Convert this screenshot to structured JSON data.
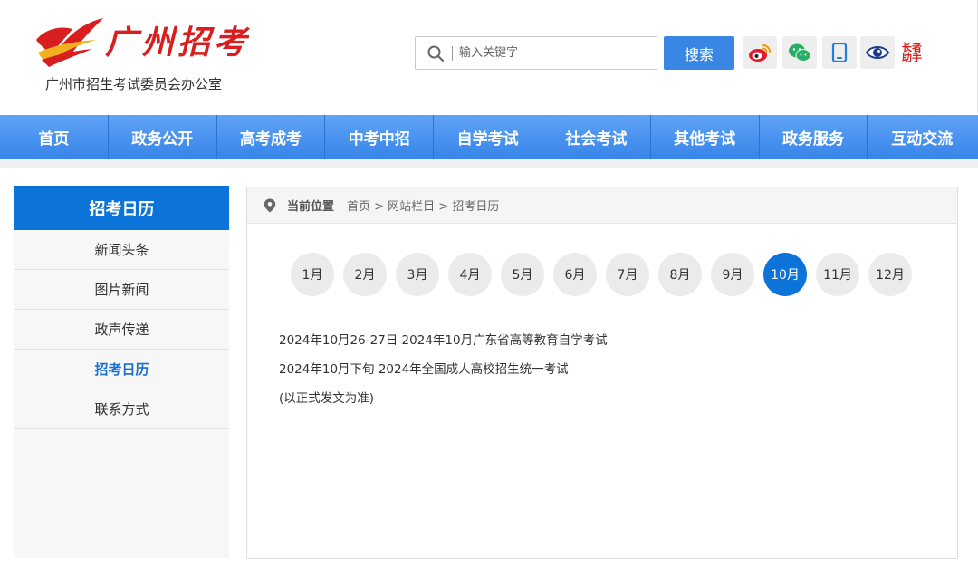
{
  "header": {
    "logo_script": "广州招考",
    "logo_subtitle": "广州市招生考试委员会办公室",
    "search_placeholder": "输入关键字",
    "search_button": "搜索",
    "tools": [
      {
        "name": "weibo",
        "icon": "weibo-icon"
      },
      {
        "name": "wechat",
        "icon": "wechat-icon"
      },
      {
        "name": "mobile",
        "icon": "mobile-icon"
      },
      {
        "name": "accessibility",
        "icon": "eye-icon"
      },
      {
        "name": "elder-assistant",
        "icon": "elder-assistant-icon",
        "label_line1": "长者",
        "label_line2": "助手"
      }
    ],
    "colors": {
      "brand_red": "#d81e1e",
      "nav_blue": "#3a86e4",
      "active_blue": "#0c74d9"
    }
  },
  "nav": {
    "items": [
      "首页",
      "政务公开",
      "高考成考",
      "中考中招",
      "自学考试",
      "社会考试",
      "其他考试",
      "政务服务",
      "互动交流"
    ]
  },
  "sidebar": {
    "title": "招考日历",
    "items": [
      {
        "label": "新闻头条",
        "active": false
      },
      {
        "label": "图片新闻",
        "active": false
      },
      {
        "label": "政声传递",
        "active": false
      },
      {
        "label": "招考日历",
        "active": true
      },
      {
        "label": "联系方式",
        "active": false
      }
    ]
  },
  "breadcrumb": {
    "label": "当前位置",
    "path": "首页 > 网站栏目 > 招考日历"
  },
  "calendar": {
    "months": [
      "1月",
      "2月",
      "3月",
      "4月",
      "5月",
      "6月",
      "7月",
      "8月",
      "9月",
      "10月",
      "11月",
      "12月"
    ],
    "selected": "10月",
    "events": [
      "2024年10月26-27日 2024年10月广东省高等教育自学考试",
      "2024年10月下旬 2024年全国成人高校招生统一考试",
      "(以正式发文为准)"
    ]
  }
}
